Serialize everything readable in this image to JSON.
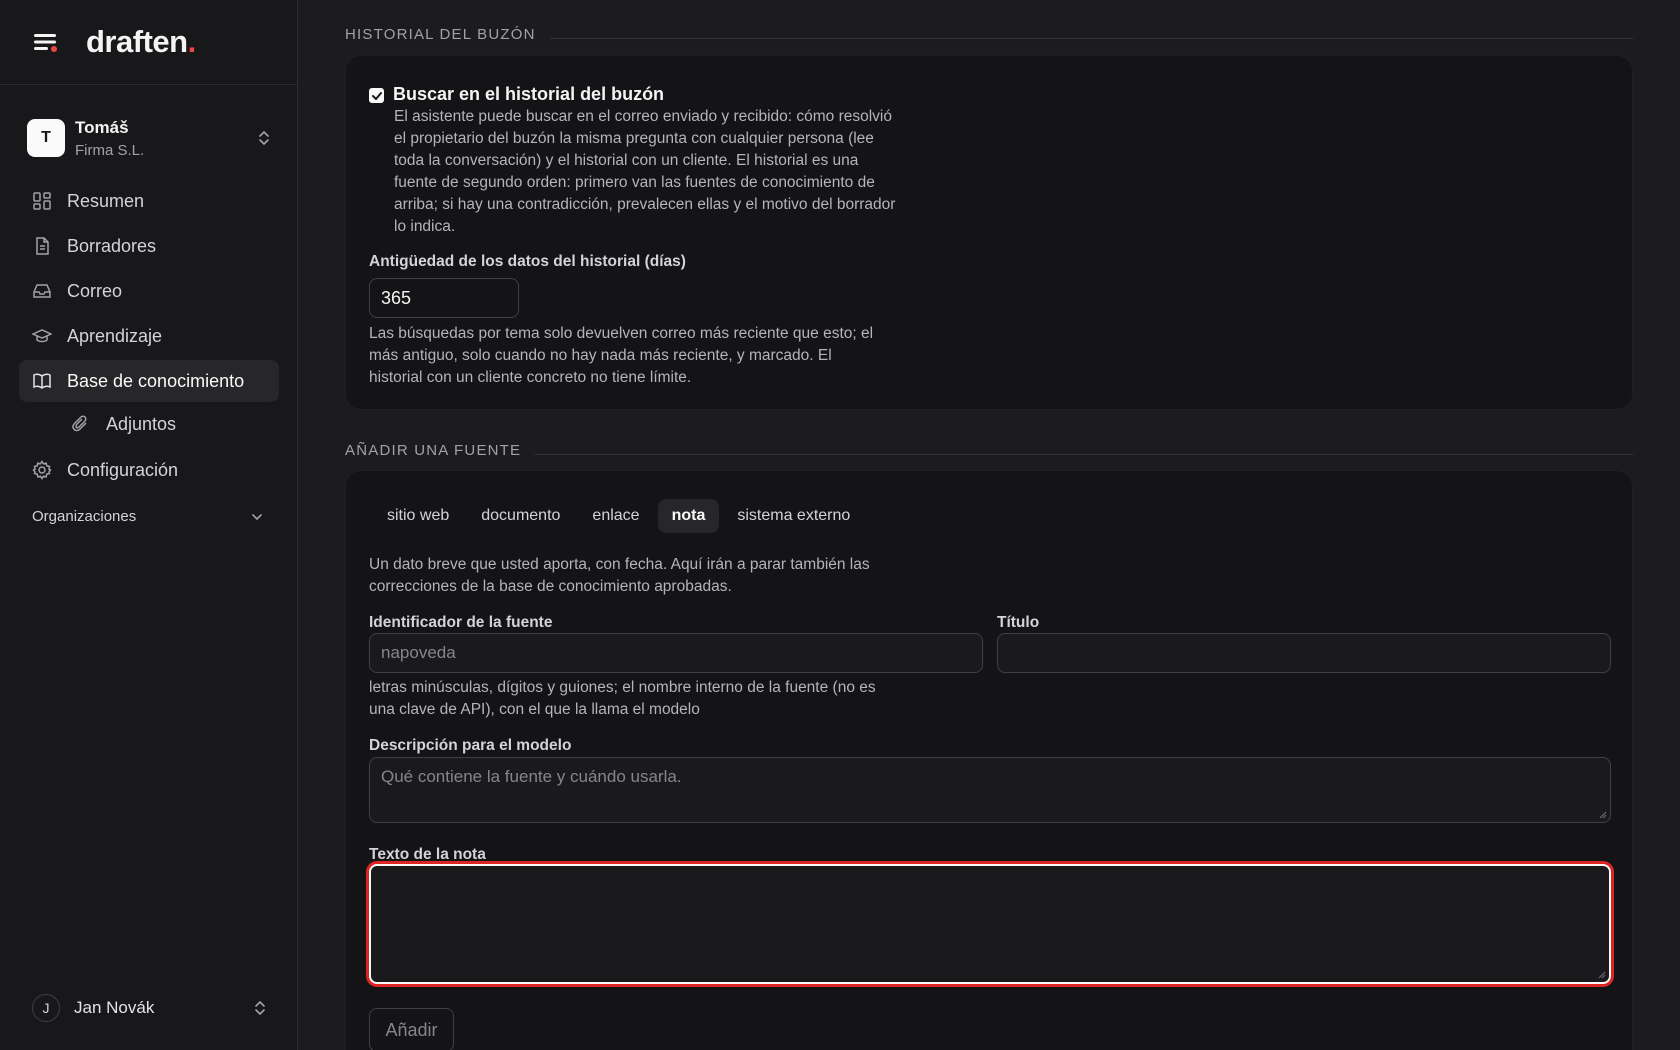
{
  "brand": {
    "name": "draften",
    "dot": "."
  },
  "account": {
    "initial": "T",
    "name": "Tomáš",
    "org": "Firma S.L."
  },
  "nav": {
    "items": [
      {
        "label": "Resumen",
        "icon": "grid-icon"
      },
      {
        "label": "Borradores",
        "icon": "document-icon"
      },
      {
        "label": "Correo",
        "icon": "inbox-icon"
      },
      {
        "label": "Aprendizaje",
        "icon": "graduation-cap-icon"
      },
      {
        "label": "Base de conocimiento",
        "icon": "book-icon",
        "active": true
      },
      {
        "label": "Adjuntos",
        "icon": "paperclip-icon",
        "sub": true
      },
      {
        "label": "Configuración",
        "icon": "gear-icon"
      }
    ],
    "group_label": "Organizaciones"
  },
  "user": {
    "initial": "J",
    "name": "Jan Novák"
  },
  "history": {
    "section_title": "HISTORIAL DEL BUZÓN",
    "checkbox_label": "Buscar en el historial del buzón",
    "checkbox_checked": true,
    "checkbox_desc": "El asistente puede buscar en el correo enviado y recibido: cómo resolvió el propietario del buzón la misma pregunta con cualquier persona (lee toda la conversación) y el historial con un cliente. El historial es una fuente de segundo orden: primero van las fuentes de conocimiento de arriba; si hay una contradicción, prevalecen ellas y el motivo del borrador lo indica.",
    "age_label": "Antigüedad de los datos del historial (días)",
    "age_value": "365",
    "age_help": "Las búsquedas por tema solo devuelven correo más reciente que esto; el más antiguo, solo cuando no hay nada más reciente, y marcado. El historial con un cliente concreto no tiene límite."
  },
  "add_source": {
    "section_title": "AÑADIR UNA FUENTE",
    "tabs": [
      "sitio web",
      "documento",
      "enlace",
      "nota",
      "sistema externo"
    ],
    "active_tab": "nota",
    "intro": "Un dato breve que usted aporta, con fecha. Aquí irán a parar también las correcciones de la base de conocimiento aprobadas.",
    "id_label": "Identificador de la fuente",
    "id_placeholder": "napoveda",
    "title_label": "Título",
    "title_value": "",
    "id_help": "letras minúsculas, dígitos y guiones; el nombre interno de la fuente (no es una clave de API), con el que la llama el modelo",
    "desc_label": "Descripción para el modelo",
    "desc_placeholder": "Qué contiene la fuente y cuándo usarla.",
    "note_label": "Texto de la nota",
    "note_value": "",
    "submit_label": "Añadir"
  },
  "colors": {
    "accent_red": "#ef4444",
    "focus_ring": "#dc2626",
    "background": "#1c1c1f"
  }
}
